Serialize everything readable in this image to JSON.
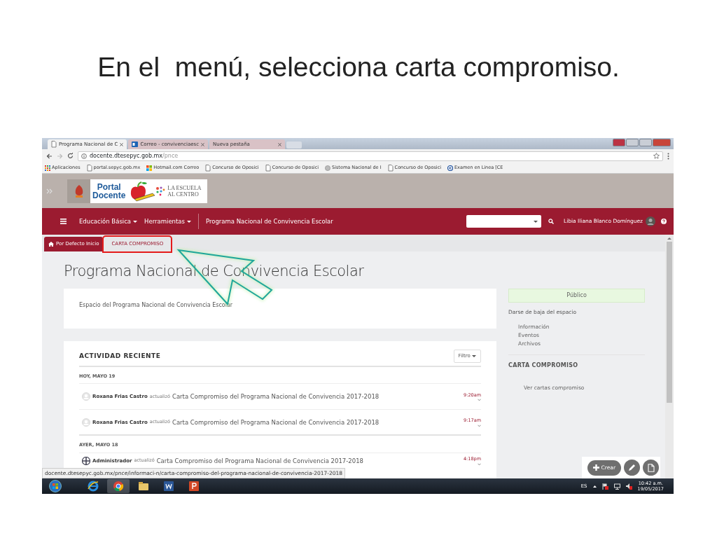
{
  "slide_title": "En el  menú, selecciona carta compromiso.",
  "browser": {
    "tabs": [
      {
        "label": "Programa Nacional de C",
        "selected": true,
        "kind": "page"
      },
      {
        "label": "Correo - convivenciaesc",
        "selected": false,
        "kind": "mail"
      },
      {
        "label": "Nueva pestaña",
        "selected": false,
        "kind": "none"
      }
    ],
    "url_host": "docente.dtesepyc.gob.mx",
    "url_path": "/pnce",
    "bookmarks": [
      {
        "label": "Aplicaciones",
        "kind": "apps"
      },
      {
        "label": "portal.sepyc.gob.mx",
        "kind": "page"
      },
      {
        "label": "Hotmail.com  Correo",
        "kind": "windows"
      },
      {
        "label": "Concurso de Oposici",
        "kind": "page"
      },
      {
        "label": "Concurso de Oposici",
        "kind": "page"
      },
      {
        "label": "Sistema Nacional de I",
        "kind": "globe"
      },
      {
        "label": "Concurso de Oposici",
        "kind": "page"
      },
      {
        "label": "Examen en Linea [CE",
        "kind": "circle"
      }
    ]
  },
  "logo": {
    "line_1": "Portal",
    "line_2": "Docente",
    "tag_1": "LA ESCUELA",
    "tag_2": "AL CENTRO"
  },
  "navbar": {
    "menus": [
      "Educación Básica",
      "Herramientas"
    ],
    "space_name": "Programa Nacional de Convivencia Escolar",
    "user_name": "Libia Iliana Blanco Domínguez"
  },
  "space_tabs": [
    {
      "label": "Por Defecto Inicio",
      "selected": true,
      "highlighted": false
    },
    {
      "label": "CARTA COMPROMISO",
      "selected": false,
      "highlighted": true
    }
  ],
  "page_title": "Programa Nacional de Convivencia Escolar",
  "description": "Espacio del Programa Nacional de Convivencia Escolar",
  "activity": {
    "title": "ACTIVIDAD RECIENTE",
    "filter": "Filtro",
    "groups": [
      {
        "date": "HOY, MAYO 19",
        "items": [
          {
            "kind": "person",
            "user": "Roxana Frias Castro",
            "action": "actualizó",
            "target": "Carta Compromiso del Programa Nacional de Convivencia 2017-2018",
            "time": "9:20am"
          },
          {
            "kind": "person",
            "user": "Roxana Frias Castro",
            "action": "actualizó",
            "target": "Carta Compromiso del Programa Nacional de Convivencia 2017-2018",
            "time": "9:17am"
          }
        ]
      },
      {
        "date": "AYER, MAYO 18",
        "items": [
          {
            "kind": "admin",
            "user": "Administrador",
            "action": "actualizó",
            "target": "Carta Compromiso del Programa Nacional de Convivencia 2017-2018",
            "time": "4:18pm"
          }
        ]
      }
    ]
  },
  "sidebar": {
    "privacy": "Público",
    "leave": "Darse de baja del espacio",
    "links": [
      "Información",
      "Eventos",
      "Archivos"
    ],
    "section_title": "CARTA COMPROMISO",
    "section_links": [
      "Ver cartas compromiso"
    ]
  },
  "create_button": "Crear",
  "status_url": "docente.dtesepyc.gob.mx/pnce/informaci-n/carta-compromiso-del-programa-nacional-de-convivencia-2017-2018",
  "taskbar": {
    "language": "ES",
    "time": "10:42 a.m.",
    "date": "19/05/2017"
  }
}
